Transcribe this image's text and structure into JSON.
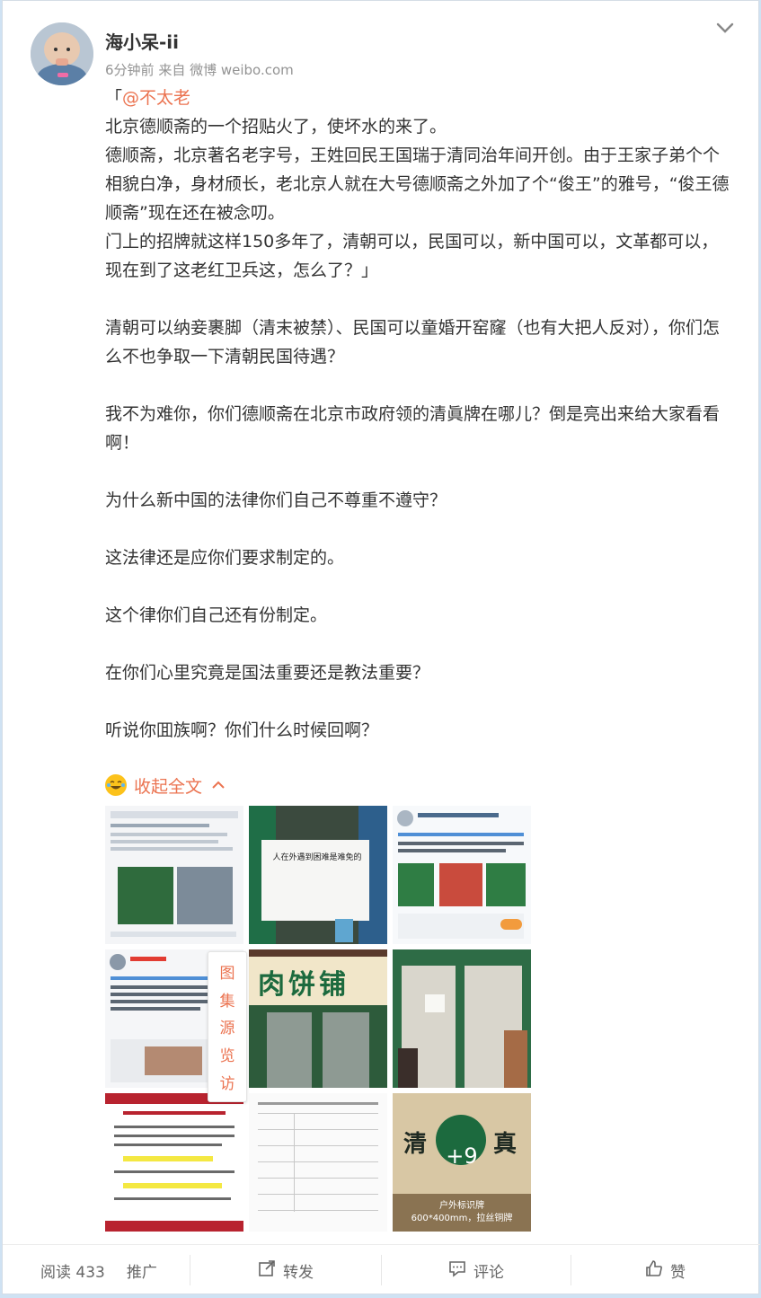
{
  "post": {
    "username": "海小呆-ii",
    "time": "6分钟前",
    "source": "来自 微博 weibo.com",
    "quote_open": "「",
    "mention": "@不太老",
    "paragraphs": [
      "北京德顺斋的一个招贴火了，使坏水的来了。",
      "德顺斋，北京著名老字号，王姓回民王国瑞于清同治年间开创。由于王家子弟个个相貌白净，身材颀长，老北京人就在大号德顺斋之外加了个“俊王”的雅号，“俊王德顺斋”现在还在被念叨。",
      "门上的招牌就这样150多年了，清朝可以，民国可以，新中国可以，文革都可以，现在到了这老红卫兵这，怎么了？」",
      "",
      "清朝可以纳妾裹脚（清末被禁）、民国可以童婚开窑窿（也有大把人反对），你们怎么不也争取一下清朝民国待遇？",
      "",
      "我不为难你，你们德顺斋在北京市政府领的清眞牌在哪儿？倒是亮出来给大家看看啊！",
      "",
      "为什么新中国的法律你们自己不尊重不遵守？",
      "",
      "这法律还是应你们要求制定的。",
      "",
      "这个律你们自己还有份制定。",
      "",
      "在你们心里究竟是国法重要还是教法重要？",
      "",
      "听说你囬族啊？你们什么时候回啊？"
    ],
    "collapse_label": "收起全文"
  },
  "images": {
    "thumb1_sign_text": "人在外遇到困难是难免的",
    "thumb2_sign_text": "肉饼铺",
    "thumb3_sign": "清",
    "thumb3_sign2": "真",
    "more_count": "+9",
    "thumb_caption": "户外标识牌",
    "thumb_caption2": "600*400mm，拉丝铜牌"
  },
  "side_tools": [
    "图",
    "集",
    "源",
    "览",
    "访"
  ],
  "footer": {
    "reads_label": "阅读 433",
    "promote_label": "推广",
    "forward_label": "转发",
    "comment_label": "评论",
    "like_label": "赞"
  },
  "colors": {
    "accent": "#eb7350",
    "text": "#333333",
    "meta": "#939393"
  }
}
